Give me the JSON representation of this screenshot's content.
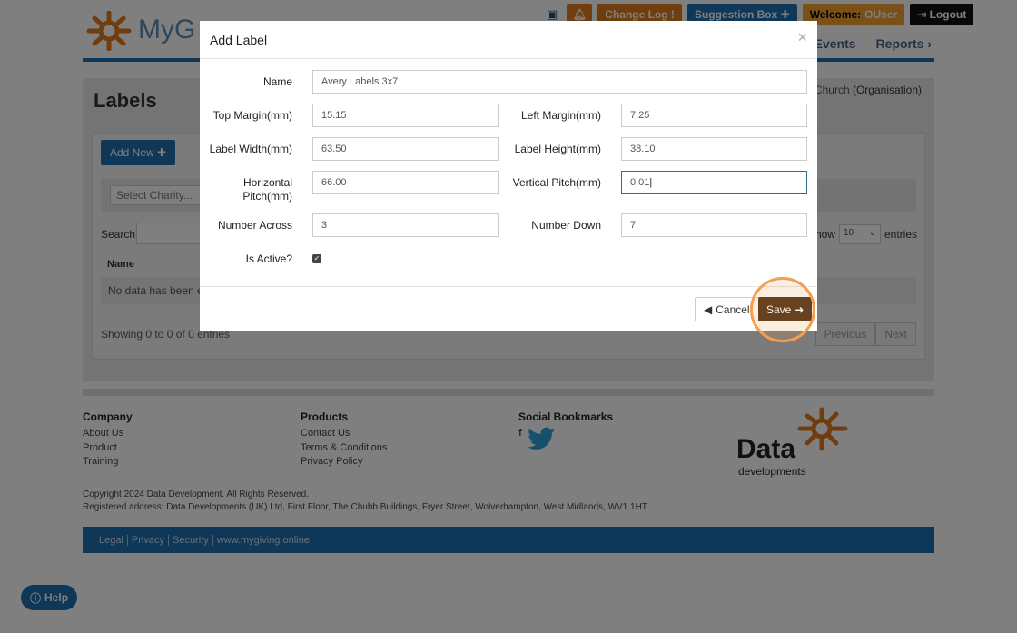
{
  "header": {
    "logo_text": "MyG",
    "buttons": {
      "change_log": "Change Log",
      "suggestion_box": "Suggestion Box",
      "welcome": "Welcome:",
      "user": "OUser",
      "logout": "Logout"
    },
    "nav": [
      "Events",
      "Reports ›"
    ]
  },
  "page": {
    "title": "Labels",
    "org_prefix": "e Church",
    "org_suffix": "(Organisation)",
    "add_new": "Add New",
    "charity_placeholder": "Select Charity...",
    "search_label": "Search:",
    "show_label": "Show",
    "show_value": "10",
    "entries_label": "entries",
    "column_name": "Name",
    "no_data": "No data has been ent",
    "showing": "Showing 0 to 0 of 0 entries",
    "pager": [
      "Previous",
      "Next"
    ]
  },
  "footer": {
    "company": {
      "title": "Company",
      "links": [
        "About Us",
        "Product",
        "Training"
      ]
    },
    "products": {
      "title": "Products",
      "links": [
        "Contact Us",
        "Terms & Conditions",
        "Privacy Policy"
      ]
    },
    "social": {
      "title": "Social Bookmarks"
    },
    "brand_word": "Data",
    "brand_sub": "developments",
    "copyright": "Copyright 2024 Data Development. All Rights Reserved.",
    "address": "Registered address: Data Developments (UK) Ltd, First Floor, The Chubb Buildings, Fryer Street, Wolverhampton, West Midlands, WV1 1HT",
    "bar_links": [
      "Legal",
      "Privacy",
      "Security",
      "www.mygiving.online"
    ]
  },
  "help": "Help",
  "modal": {
    "title": "Add Label",
    "close": "×",
    "fields": {
      "name": {
        "label": "Name",
        "value": "Avery Labels 3x7"
      },
      "top_margin": {
        "label": "Top Margin(mm)",
        "value": "15.15"
      },
      "left_margin": {
        "label": "Left Margin(mm)",
        "value": "7.25"
      },
      "label_width": {
        "label": "Label Width(mm)",
        "value": "63.50"
      },
      "label_height": {
        "label": "Label Height(mm)",
        "value": "38.10"
      },
      "horizontal_pitch": {
        "label": "Horizontal Pitch(mm)",
        "value": "66.00"
      },
      "vertical_pitch": {
        "label": "Vertical Pitch(mm)",
        "value": "0.01"
      },
      "number_across": {
        "label": "Number Across",
        "value": "3"
      },
      "number_down": {
        "label": "Number Down",
        "value": "7"
      },
      "is_active": {
        "label": "Is Active?",
        "checked": true
      }
    },
    "cancel": "Cancel",
    "save": "Save"
  },
  "colors": {
    "brand_blue": "#1f6fb0",
    "save_button": "#4a2e18",
    "highlight": "#f0a050"
  }
}
